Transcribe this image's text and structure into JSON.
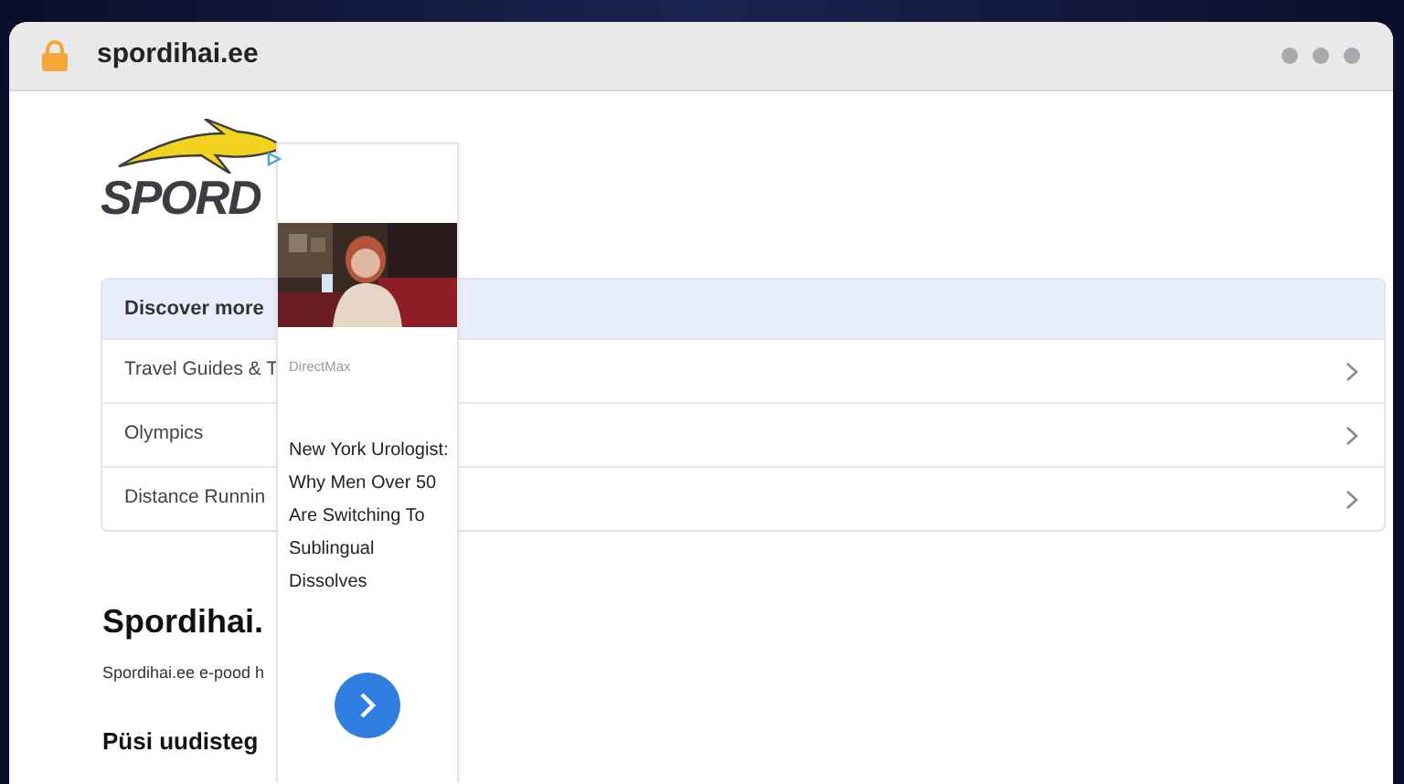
{
  "browser": {
    "address": "spordihai.ee"
  },
  "logo": {
    "text": "SPORD"
  },
  "discover": {
    "title": "Discover more",
    "items": [
      {
        "label": "Travel Guides & T"
      },
      {
        "label": "Olympics"
      },
      {
        "label": "Distance Runnin"
      }
    ]
  },
  "ad": {
    "kind": "picture",
    "advertiser": "DirectMax",
    "headline": "New York Urologist: Why Men Over 50 Are Switching To Sublingual Dissolves"
  },
  "article": {
    "heading": "Spordihai.",
    "intro": "Spordihai.ee e-pood h",
    "subheading": "Püsi uudisteg"
  }
}
